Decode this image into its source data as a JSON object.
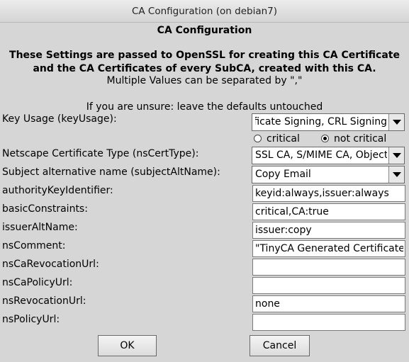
{
  "window": {
    "title": "CA Configuration (on debian7)"
  },
  "header": {
    "heading": "CA Configuration",
    "bold_line1": "These Settings are passed to OpenSSL for creating this CA Certificate",
    "bold_line2": "and the CA Certificates of every SubCA, created with this CA.",
    "note": "Multiple Values can be separated by \",\"",
    "unsure": "If you are unsure: leave the defaults untouched"
  },
  "fields": {
    "key_usage": {
      "label": "Key Usage (keyUsage):",
      "value": "Certificate Signing, CRL Signing"
    },
    "critical_radio": {
      "label": "critical",
      "selected": false
    },
    "not_critical_radio": {
      "label": "not critical",
      "selected": true
    },
    "ns_cert_type": {
      "label": "Netscape Certificate Type (nsCertType):",
      "value": "SSL CA, S/MIME CA, Object Signing CA"
    },
    "subject_alt_name": {
      "label": "Subject alternative name (subjectAltName):",
      "value": "Copy Email"
    },
    "authority_key_identifier": {
      "label": "authorityKeyIdentifier:",
      "value": "keyid:always,issuer:always"
    },
    "basic_constraints": {
      "label": "basicConstraints:",
      "value": "critical,CA:true"
    },
    "issuer_alt_name": {
      "label": "issuerAltName:",
      "value": "issuer:copy"
    },
    "ns_comment": {
      "label": "nsComment:",
      "value": "\"TinyCA Generated Certificate\""
    },
    "ns_ca_revocation_url": {
      "label": "nsCaRevocationUrl:",
      "value": ""
    },
    "ns_ca_policy_url": {
      "label": "nsCaPolicyUrl:",
      "value": ""
    },
    "ns_revocation_url": {
      "label": "nsRevocationUrl:",
      "value": "none"
    },
    "ns_policy_url": {
      "label": "nsPolicyUrl:",
      "value": ""
    }
  },
  "buttons": {
    "ok": "OK",
    "cancel": "Cancel"
  },
  "icons": {
    "dropdown": "chevron-down-icon"
  }
}
